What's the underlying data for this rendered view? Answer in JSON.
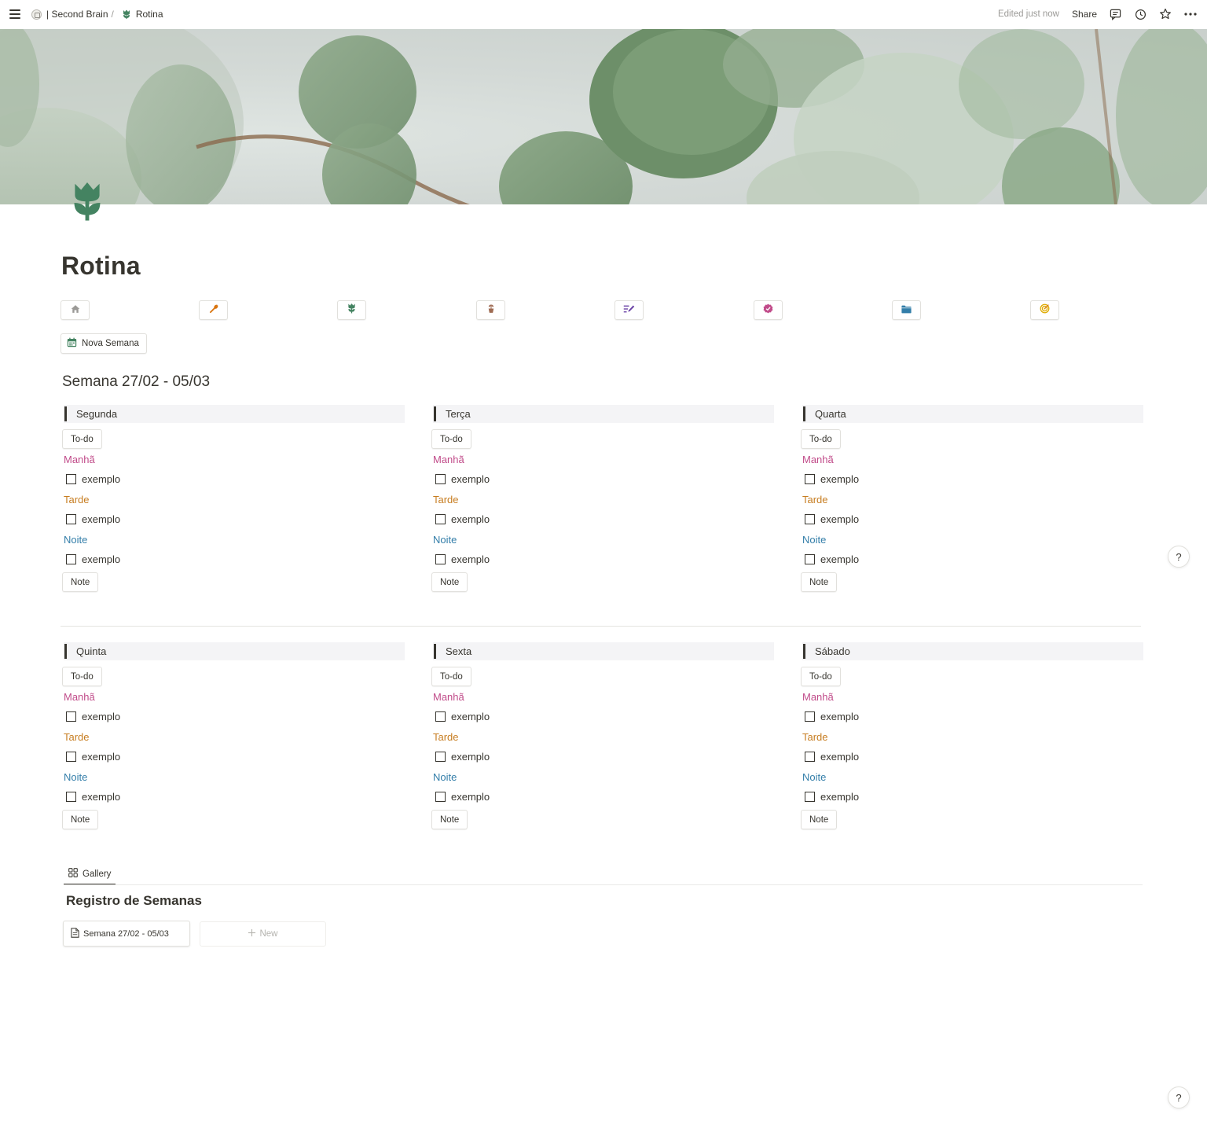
{
  "topbar": {
    "breadcrumb_parent": "| Second Brain",
    "breadcrumb_sep": "/",
    "breadcrumb_current": "Rotina",
    "edited": "Edited just now",
    "share": "Share"
  },
  "page": {
    "title": "Rotina",
    "icon": "tulip-icon"
  },
  "links": [
    {
      "icon": "home-icon",
      "color": "#9b9a97"
    },
    {
      "icon": "wrench-icon",
      "color": "#d9730d"
    },
    {
      "icon": "tulip-icon",
      "color": "#448361"
    },
    {
      "icon": "potted-plant-icon",
      "color": "#9f6b53"
    },
    {
      "icon": "write-icon",
      "color": "#6940a5"
    },
    {
      "icon": "verified-badge-icon",
      "color": "#c14c8a"
    },
    {
      "icon": "folder-icon",
      "color": "#337ea9"
    },
    {
      "icon": "target-icon",
      "color": "#dfab01"
    }
  ],
  "nova_semana": "Nova Semana",
  "week_heading": "Semana 27/02 - 05/03",
  "labels": {
    "todo": "To-do",
    "manha": "Manhã",
    "tarde": "Tarde",
    "noite": "Noite",
    "note": "Note"
  },
  "days": [
    {
      "name": "Segunda",
      "tasks": [
        "exemplo",
        "exemplo",
        "exemplo"
      ]
    },
    {
      "name": "Terça",
      "tasks": [
        "exemplo",
        "exemplo",
        "exemplo"
      ]
    },
    {
      "name": "Quarta",
      "tasks": [
        "exemplo",
        "exemplo",
        "exemplo"
      ]
    },
    {
      "name": "Quinta",
      "tasks": [
        "exemplo",
        "exemplo",
        "exemplo"
      ]
    },
    {
      "name": "Sexta",
      "tasks": [
        "exemplo",
        "exemplo",
        "exemplo"
      ]
    },
    {
      "name": "Sábado",
      "tasks": [
        "exemplo",
        "exemplo",
        "exemplo"
      ]
    }
  ],
  "gallery": {
    "tab": "Gallery",
    "title": "Registro de Semanas",
    "card": "Semana 27/02 - 05/03",
    "new": "New"
  },
  "help": "?"
}
